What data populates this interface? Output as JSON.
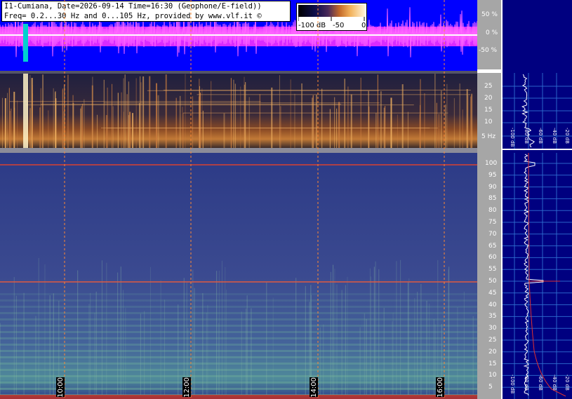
{
  "header": {
    "line1": "I1-Cumiana, Date=2026-09-14 Time=16:30 (Geophone/E-field))",
    "line2": "Freq= 0.2...30 Hz and 0...105 Hz, provided by www.vlf.it ©"
  },
  "scale": {
    "min_label": "-100 dB",
    "mid_label": "-50",
    "max_label": "0"
  },
  "waveform_axis": [
    "50 %",
    "0 %",
    "-50 %"
  ],
  "geophone_axis": [
    "25",
    "20",
    "15",
    "10",
    "5 Hz"
  ],
  "efield_axis": [
    "100",
    "95",
    "90",
    "85",
    "80",
    "75",
    "70",
    "65",
    "60",
    "55",
    "50",
    "45",
    "40",
    "35",
    "30",
    "25",
    "20",
    "15",
    "10",
    "5"
  ],
  "time_labels": [
    "10:00",
    "12:00",
    "14:00",
    "16:00"
  ],
  "spectrum_labels_top": [
    "-100 dB",
    "-80 dB",
    "-60 dB",
    "-40 dB",
    "-20 dB"
  ],
  "spectrum_labels_bottom": [
    "-100 dB",
    "-80 dB",
    "-60 dB",
    "-40 dB",
    "-20 dB"
  ],
  "colors": {
    "waveform_bg": "#0000ff",
    "waveform_trace": "#ff33ff",
    "geophone_bg": "#2a2a55",
    "efield_bg": "#3b4a8c",
    "panel_bg": "#000080",
    "marker_line": "#ff8833"
  }
}
